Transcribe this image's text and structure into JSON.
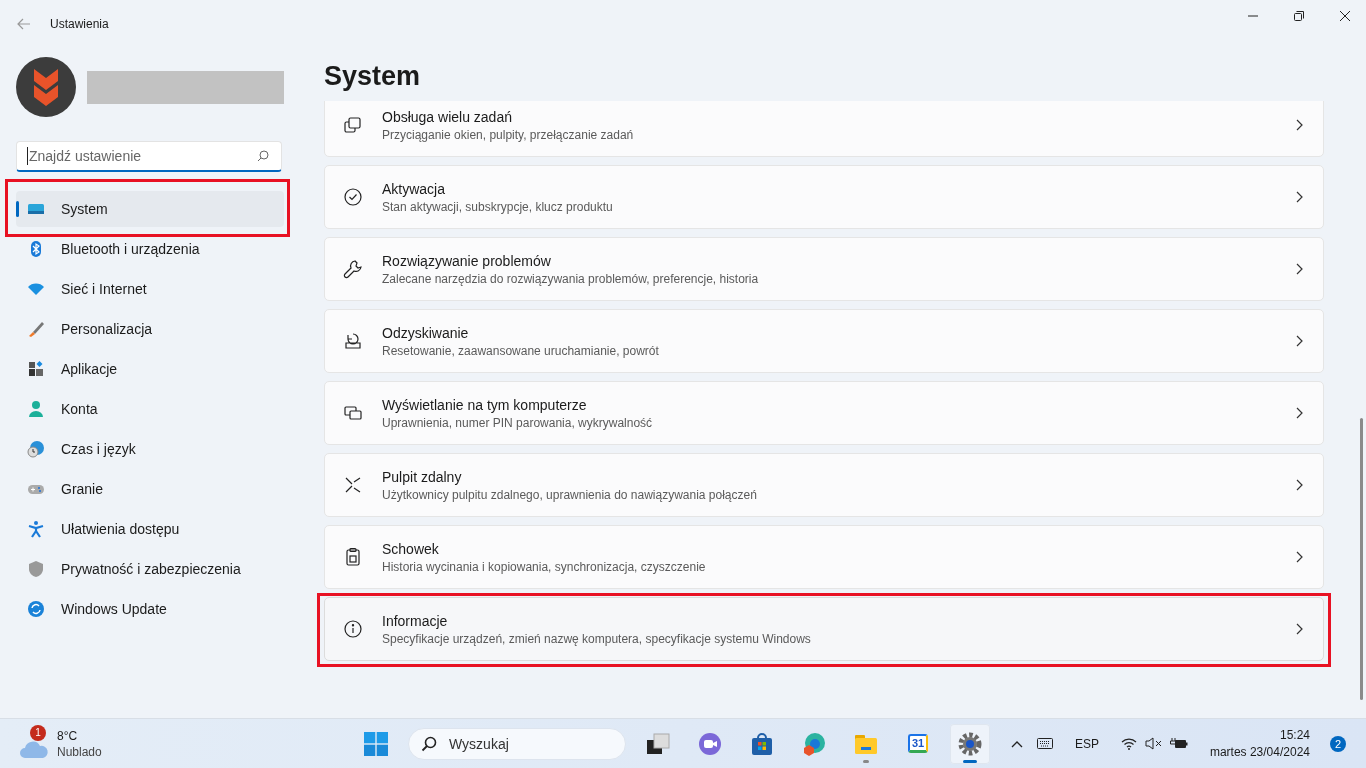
{
  "window": {
    "title": "Ustawienia"
  },
  "search": {
    "placeholder": "Znajdź ustawienie"
  },
  "sidebar": {
    "items": [
      {
        "label": "System",
        "selected": true,
        "highlighted": true
      },
      {
        "label": "Bluetooth i urządzenia",
        "selected": false,
        "highlighted": false
      },
      {
        "label": "Sieć i Internet",
        "selected": false,
        "highlighted": false
      },
      {
        "label": "Personalizacja",
        "selected": false,
        "highlighted": false
      },
      {
        "label": "Aplikacje",
        "selected": false,
        "highlighted": false
      },
      {
        "label": "Konta",
        "selected": false,
        "highlighted": false
      },
      {
        "label": "Czas i język",
        "selected": false,
        "highlighted": false
      },
      {
        "label": "Granie",
        "selected": false,
        "highlighted": false
      },
      {
        "label": "Ułatwienia dostępu",
        "selected": false,
        "highlighted": false
      },
      {
        "label": "Prywatność i zabezpieczenia",
        "selected": false,
        "highlighted": false
      },
      {
        "label": "Windows Update",
        "selected": false,
        "highlighted": false
      }
    ]
  },
  "page": {
    "title": "System",
    "settings": [
      {
        "title": "Obsługa wielu zadań",
        "description": "Przyciąganie okien, pulpity, przełączanie zadań",
        "highlighted": false
      },
      {
        "title": "Aktywacja",
        "description": "Stan aktywacji, subskrypcje, klucz produktu",
        "highlighted": false
      },
      {
        "title": "Rozwiązywanie problemów",
        "description": "Zalecane narzędzia do rozwiązywania problemów, preferencje, historia",
        "highlighted": false
      },
      {
        "title": "Odzyskiwanie",
        "description": "Resetowanie, zaawansowane uruchamianie, powrót",
        "highlighted": false
      },
      {
        "title": "Wyświetlanie na tym komputerze",
        "description": "Uprawnienia, numer PIN parowania, wykrywalność",
        "highlighted": false
      },
      {
        "title": "Pulpit zdalny",
        "description": "Użytkownicy pulpitu zdalnego, uprawnienia do nawiązywania połączeń",
        "highlighted": false
      },
      {
        "title": "Schowek",
        "description": "Historia wycinania i kopiowania, synchronizacja, czyszczenie",
        "highlighted": false
      },
      {
        "title": "Informacje",
        "description": "Specyfikacje urządzeń, zmień nazwę komputera, specyfikacje systemu Windows",
        "highlighted": true
      }
    ]
  },
  "taskbar": {
    "weather": {
      "badge": "1",
      "temperature": "8°C",
      "condition": "Nublado"
    },
    "search": {
      "placeholder": "Wyszukaj"
    },
    "apps": [
      {
        "running": false,
        "active": false
      },
      {
        "running": false,
        "active": false
      },
      {
        "running": false,
        "active": false
      },
      {
        "running": false,
        "active": false
      },
      {
        "running": true,
        "active": false
      },
      {
        "running": false,
        "active": false,
        "label": "31"
      },
      {
        "running": true,
        "active": true
      }
    ],
    "language": "ESP",
    "time": "15:24",
    "date": "martes 23/04/2024",
    "notifications": "2"
  }
}
